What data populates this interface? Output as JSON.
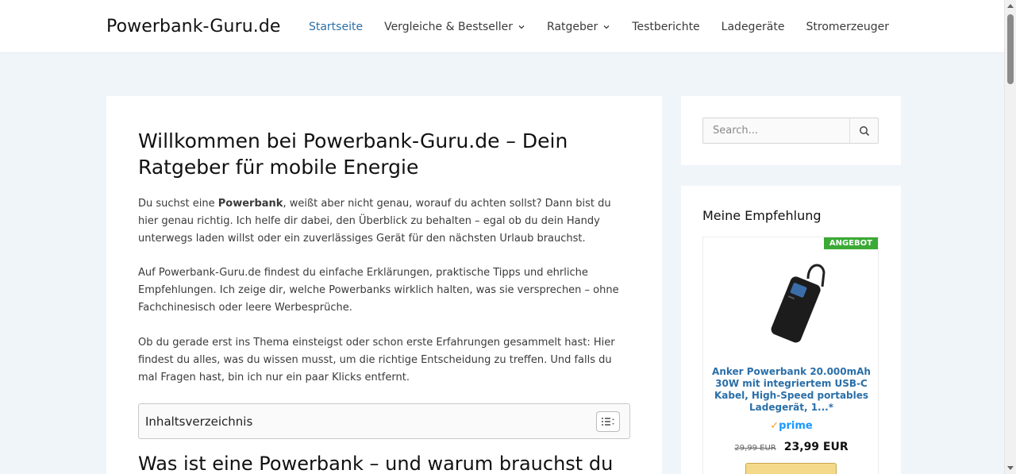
{
  "header": {
    "logo": "Powerbank-Guru.de",
    "nav": [
      {
        "label": "Startseite",
        "active": true,
        "dropdown": false
      },
      {
        "label": "Vergleiche & Bestseller",
        "active": false,
        "dropdown": true
      },
      {
        "label": "Ratgeber",
        "active": false,
        "dropdown": true
      },
      {
        "label": "Testberichte",
        "active": false,
        "dropdown": false
      },
      {
        "label": "Ladegeräte",
        "active": false,
        "dropdown": false
      },
      {
        "label": "Stromerzeuger",
        "active": false,
        "dropdown": false
      }
    ]
  },
  "article": {
    "title": "Willkommen bei Powerbank-Guru.de – Dein Ratgeber für mobile Energie",
    "p1_before": "Du suchst eine ",
    "p1_bold": "Powerbank",
    "p1_after": ", weißt aber nicht genau, worauf du achten sollst? Dann bist du hier genau richtig. Ich helfe dir dabei, den Überblick zu behalten – egal ob du dein Handy unterwegs laden willst oder ein zuverlässiges Gerät für den nächsten Urlaub brauchst.",
    "p2": "Auf Powerbank-Guru.de findest du einfache Erklärungen, praktische Tipps und ehrliche Empfehlungen. Ich zeige dir, welche Powerbanks wirklich halten, was sie versprechen – ohne Fachchinesisch oder leere Werbesprüche.",
    "p3": "Ob du gerade erst ins Thema einsteigst oder schon erste Erfahrungen gesammelt hast: Hier findest du alles, was du wissen musst, um die richtige Entscheidung zu treffen. Und falls du mal Fragen hast, bin ich nur ein paar Klicks entfernt.",
    "toc_title": "Inhaltsverzeichnis",
    "h2": "Was ist eine Powerbank – und warum brauchst du"
  },
  "sidebar": {
    "search_placeholder": "Search...",
    "recommendation_title": "Meine Empfehlung",
    "product": {
      "badge": "ANGEBOT",
      "title": "Anker Powerbank 20.000mAh 30W mit integriertem USB-C Kabel, High-Speed portables Ladegerät, 1...*",
      "prime_check": "✓",
      "prime_label": "prime",
      "old_price": "29,99 EUR",
      "new_price": "23,99 EUR"
    }
  },
  "colors": {
    "accent": "#2a6fa8",
    "page_bg": "#f0f5fa",
    "badge": "#3aaa35"
  }
}
